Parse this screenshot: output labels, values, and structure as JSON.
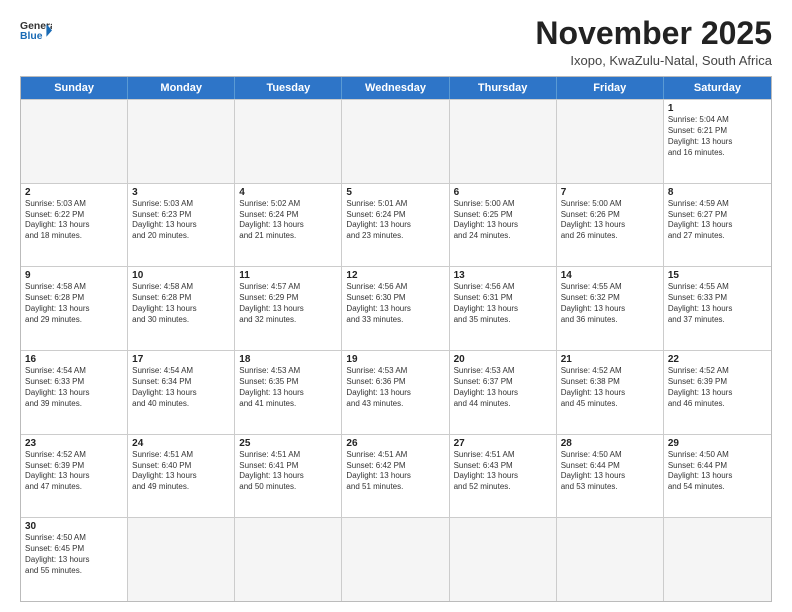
{
  "header": {
    "logo_general": "General",
    "logo_blue": "Blue",
    "title": "November 2025",
    "subtitle": "Ixopo, KwaZulu-Natal, South Africa"
  },
  "days_of_week": [
    "Sunday",
    "Monday",
    "Tuesday",
    "Wednesday",
    "Thursday",
    "Friday",
    "Saturday"
  ],
  "rows": [
    [
      {
        "day": "",
        "empty": true
      },
      {
        "day": "",
        "empty": true
      },
      {
        "day": "",
        "empty": true
      },
      {
        "day": "",
        "empty": true
      },
      {
        "day": "",
        "empty": true
      },
      {
        "day": "",
        "empty": true
      },
      {
        "day": "1",
        "sunrise": "5:04 AM",
        "sunset": "6:21 PM",
        "daylight": "13 hours and 16 minutes."
      }
    ],
    [
      {
        "day": "2",
        "sunrise": "5:03 AM",
        "sunset": "6:22 PM",
        "daylight": "13 hours and 18 minutes."
      },
      {
        "day": "3",
        "sunrise": "5:03 AM",
        "sunset": "6:23 PM",
        "daylight": "13 hours and 20 minutes."
      },
      {
        "day": "4",
        "sunrise": "5:02 AM",
        "sunset": "6:24 PM",
        "daylight": "13 hours and 21 minutes."
      },
      {
        "day": "5",
        "sunrise": "5:01 AM",
        "sunset": "6:24 PM",
        "daylight": "13 hours and 23 minutes."
      },
      {
        "day": "6",
        "sunrise": "5:00 AM",
        "sunset": "6:25 PM",
        "daylight": "13 hours and 24 minutes."
      },
      {
        "day": "7",
        "sunrise": "5:00 AM",
        "sunset": "6:26 PM",
        "daylight": "13 hours and 26 minutes."
      },
      {
        "day": "8",
        "sunrise": "4:59 AM",
        "sunset": "6:27 PM",
        "daylight": "13 hours and 27 minutes."
      }
    ],
    [
      {
        "day": "9",
        "sunrise": "4:58 AM",
        "sunset": "6:28 PM",
        "daylight": "13 hours and 29 minutes."
      },
      {
        "day": "10",
        "sunrise": "4:58 AM",
        "sunset": "6:28 PM",
        "daylight": "13 hours and 30 minutes."
      },
      {
        "day": "11",
        "sunrise": "4:57 AM",
        "sunset": "6:29 PM",
        "daylight": "13 hours and 32 minutes."
      },
      {
        "day": "12",
        "sunrise": "4:56 AM",
        "sunset": "6:30 PM",
        "daylight": "13 hours and 33 minutes."
      },
      {
        "day": "13",
        "sunrise": "4:56 AM",
        "sunset": "6:31 PM",
        "daylight": "13 hours and 35 minutes."
      },
      {
        "day": "14",
        "sunrise": "4:55 AM",
        "sunset": "6:32 PM",
        "daylight": "13 hours and 36 minutes."
      },
      {
        "day": "15",
        "sunrise": "4:55 AM",
        "sunset": "6:33 PM",
        "daylight": "13 hours and 37 minutes."
      }
    ],
    [
      {
        "day": "16",
        "sunrise": "4:54 AM",
        "sunset": "6:33 PM",
        "daylight": "13 hours and 39 minutes."
      },
      {
        "day": "17",
        "sunrise": "4:54 AM",
        "sunset": "6:34 PM",
        "daylight": "13 hours and 40 minutes."
      },
      {
        "day": "18",
        "sunrise": "4:53 AM",
        "sunset": "6:35 PM",
        "daylight": "13 hours and 41 minutes."
      },
      {
        "day": "19",
        "sunrise": "4:53 AM",
        "sunset": "6:36 PM",
        "daylight": "13 hours and 43 minutes."
      },
      {
        "day": "20",
        "sunrise": "4:53 AM",
        "sunset": "6:37 PM",
        "daylight": "13 hours and 44 minutes."
      },
      {
        "day": "21",
        "sunrise": "4:52 AM",
        "sunset": "6:38 PM",
        "daylight": "13 hours and 45 minutes."
      },
      {
        "day": "22",
        "sunrise": "4:52 AM",
        "sunset": "6:39 PM",
        "daylight": "13 hours and 46 minutes."
      }
    ],
    [
      {
        "day": "23",
        "sunrise": "4:52 AM",
        "sunset": "6:39 PM",
        "daylight": "13 hours and 47 minutes."
      },
      {
        "day": "24",
        "sunrise": "4:51 AM",
        "sunset": "6:40 PM",
        "daylight": "13 hours and 49 minutes."
      },
      {
        "day": "25",
        "sunrise": "4:51 AM",
        "sunset": "6:41 PM",
        "daylight": "13 hours and 50 minutes."
      },
      {
        "day": "26",
        "sunrise": "4:51 AM",
        "sunset": "6:42 PM",
        "daylight": "13 hours and 51 minutes."
      },
      {
        "day": "27",
        "sunrise": "4:51 AM",
        "sunset": "6:43 PM",
        "daylight": "13 hours and 52 minutes."
      },
      {
        "day": "28",
        "sunrise": "4:50 AM",
        "sunset": "6:44 PM",
        "daylight": "13 hours and 53 minutes."
      },
      {
        "day": "29",
        "sunrise": "4:50 AM",
        "sunset": "6:44 PM",
        "daylight": "13 hours and 54 minutes."
      }
    ],
    [
      {
        "day": "30",
        "sunrise": "4:50 AM",
        "sunset": "6:45 PM",
        "daylight": "13 hours and 55 minutes."
      },
      {
        "day": "",
        "empty": true
      },
      {
        "day": "",
        "empty": true
      },
      {
        "day": "",
        "empty": true
      },
      {
        "day": "",
        "empty": true
      },
      {
        "day": "",
        "empty": true
      },
      {
        "day": "",
        "empty": true
      }
    ]
  ],
  "labels": {
    "sunrise": "Sunrise:",
    "sunset": "Sunset:",
    "daylight": "Daylight:"
  },
  "colors": {
    "header_bg": "#2e75c8",
    "accent_blue": "#1a6bb5"
  }
}
